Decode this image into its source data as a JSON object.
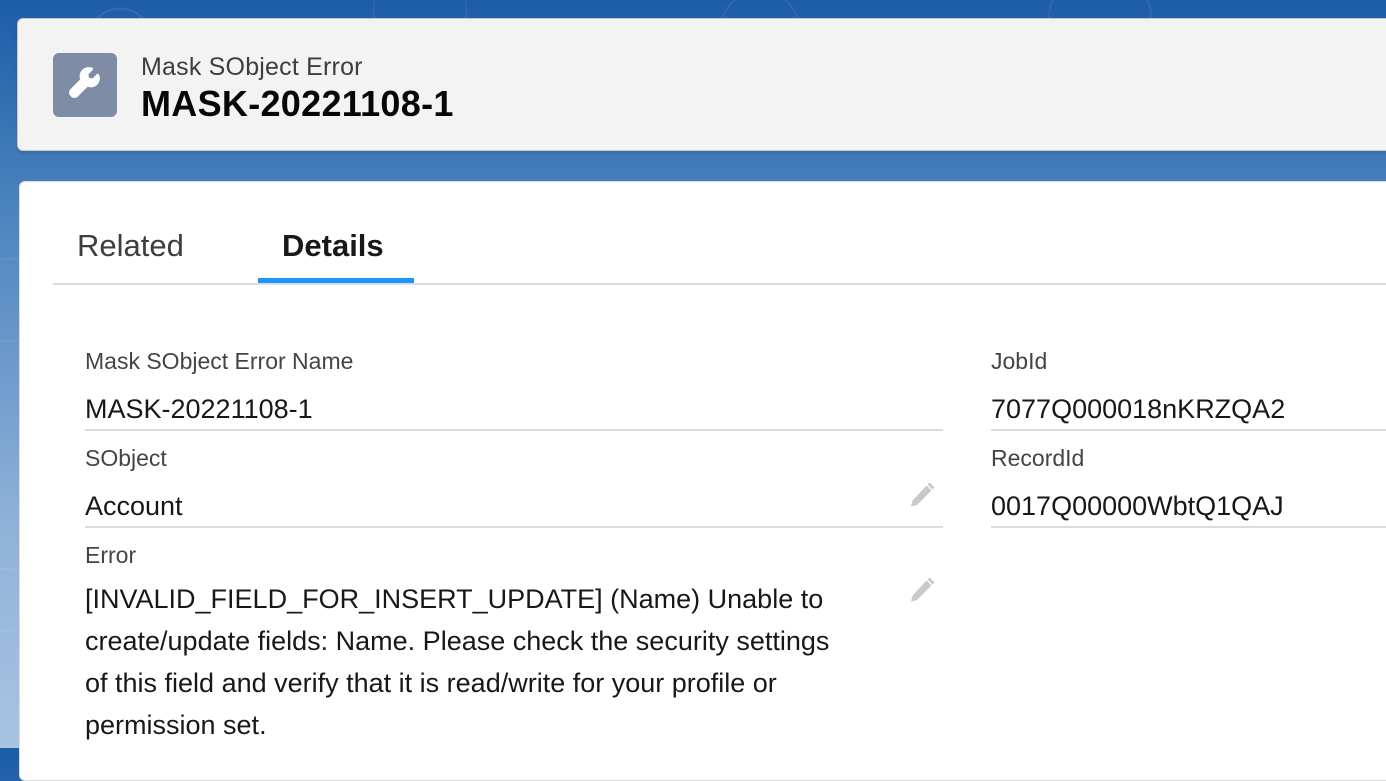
{
  "header": {
    "entity_label": "Mask SObject Error",
    "record_name": "MASK-20221108-1",
    "icon": "wrench-icon",
    "icon_color": "#7f8ca6"
  },
  "tabs": [
    {
      "label": "Related",
      "active": false
    },
    {
      "label": "Details",
      "active": true
    }
  ],
  "accent_color": "#1b96ff",
  "fields": {
    "name": {
      "label": "Mask SObject Error Name",
      "value": "MASK-20221108-1",
      "editable": false
    },
    "sobject": {
      "label": "SObject",
      "value": "Account",
      "editable": true
    },
    "error": {
      "label": "Error",
      "value": "[INVALID_FIELD_FOR_INSERT_UPDATE] (Name) Unable to create/update fields: Name. Please check the security settings of this field and verify that it is read/write for your profile or permission set.",
      "editable": true
    },
    "job_id": {
      "label": "JobId",
      "value": "7077Q000018nKRZQA2",
      "editable": false
    },
    "record_id": {
      "label": "RecordId",
      "value": "0017Q00000WbtQ1QAJ",
      "editable": false
    }
  }
}
